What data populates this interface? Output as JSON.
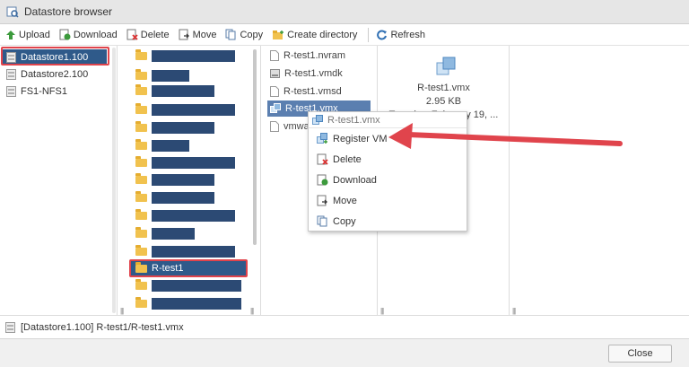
{
  "window": {
    "title": "Datastore browser"
  },
  "toolbar": {
    "upload": "Upload",
    "download": "Download",
    "delete": "Delete",
    "move": "Move",
    "copy": "Copy",
    "create_directory": "Create directory",
    "refresh": "Refresh"
  },
  "datastores": [
    "Datastore1.100",
    "Datastore2.100",
    "FS1-NFS1"
  ],
  "folders": {
    "selected": "R-test1"
  },
  "files": [
    "R-test1.nvram",
    "R-test1.vmdk",
    "R-test1.vmsd",
    "R-test1.vmx",
    "vmware"
  ],
  "details": {
    "name": "R-test1.vmx",
    "size": "2.95 KB",
    "date": "Tuesday, February 19, ..."
  },
  "context_menu": {
    "header": "R-test1.vmx",
    "items": [
      "Register VM",
      "Delete",
      "Download",
      "Move",
      "Copy"
    ]
  },
  "path": "[Datastore1.100] R-test1/R-test1.vmx",
  "close_label": "Close",
  "colors": {
    "selection": "#2f5a8a",
    "redaction": "#2c4a74",
    "annotation": "#e0444c",
    "folder": "#f1c24e"
  }
}
